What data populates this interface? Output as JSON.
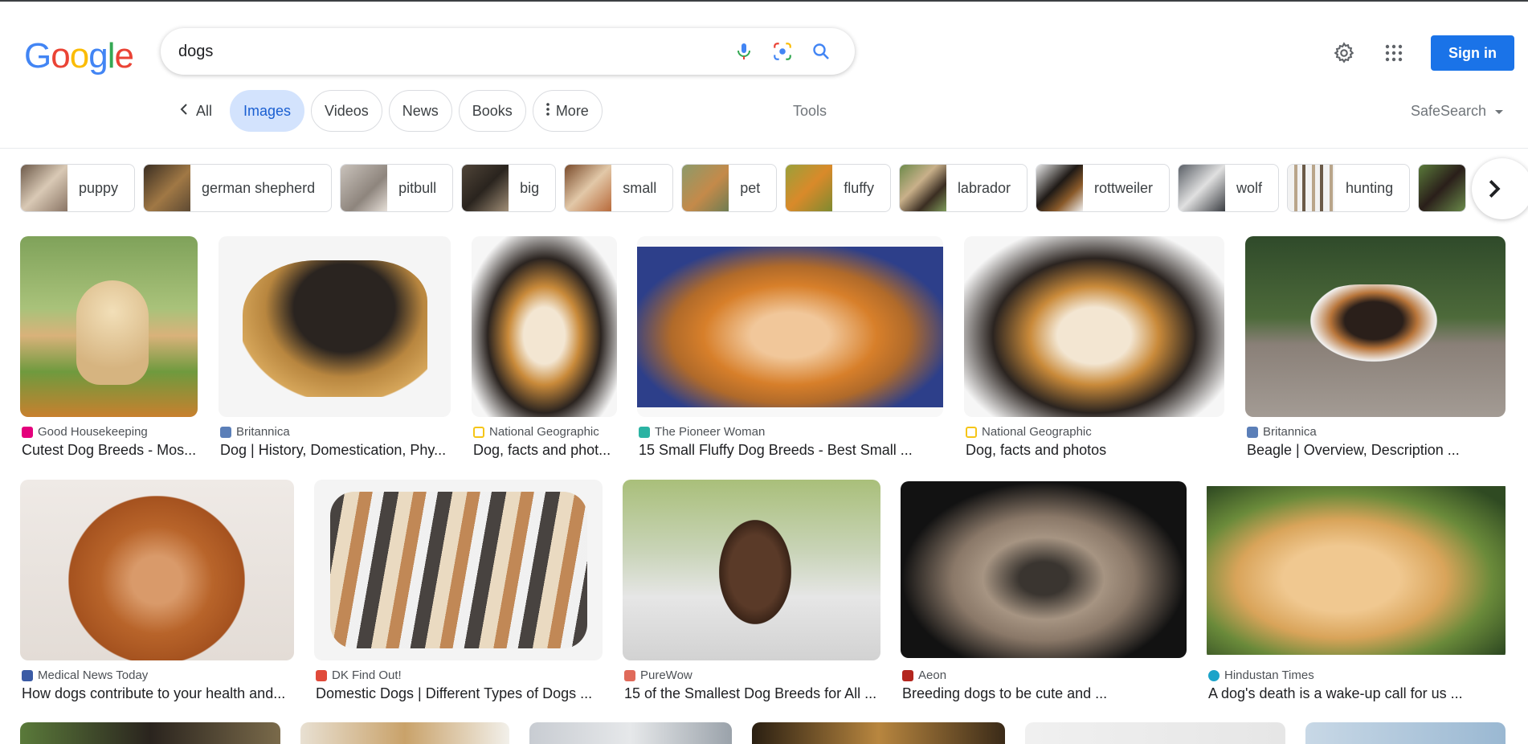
{
  "search": {
    "query": "dogs"
  },
  "header": {
    "sign_in": "Sign in"
  },
  "colors": {
    "accent": "#1a73e8",
    "active_tab_bg": "#d3e3fd"
  },
  "tabs": [
    {
      "label": "All",
      "icon": "chevron-left-icon"
    },
    {
      "label": "Images",
      "active": true
    },
    {
      "label": "Videos"
    },
    {
      "label": "News"
    },
    {
      "label": "Books"
    },
    {
      "label": "More",
      "icon": "more-vert-icon"
    }
  ],
  "tools_label": "Tools",
  "safesearch_label": "SafeSearch",
  "chips": [
    {
      "label": "puppy"
    },
    {
      "label": "german shepherd"
    },
    {
      "label": "pitbull"
    },
    {
      "label": "big"
    },
    {
      "label": "small"
    },
    {
      "label": "pet"
    },
    {
      "label": "fluffy"
    },
    {
      "label": "labrador"
    },
    {
      "label": "rottweiler"
    },
    {
      "label": "wolf"
    },
    {
      "label": "hunting"
    }
  ],
  "results": [
    {
      "source": "Good Housekeeping",
      "title": "Cutest Dog Breeds - Mos..."
    },
    {
      "source": "Britannica",
      "title": "Dog | History, Domestication, Phy..."
    },
    {
      "source": "National Geographic",
      "title": "Dog, facts and phot..."
    },
    {
      "source": "The Pioneer Woman",
      "title": "15 Small Fluffy Dog Breeds - Best Small ..."
    },
    {
      "source": "National Geographic",
      "title": "Dog, facts and photos"
    },
    {
      "source": "Britannica",
      "title": "Beagle | Overview, Description ..."
    },
    {
      "source": "Medical News Today",
      "title": "How dogs contribute to your health and..."
    },
    {
      "source": "DK Find Out!",
      "title": "Domestic Dogs | Different Types of Dogs ..."
    },
    {
      "source": "PureWow",
      "title": "15 of the Smallest Dog Breeds for All ..."
    },
    {
      "source": "Aeon",
      "title": "Breeding dogs to be cute and ..."
    },
    {
      "source": "Hindustan Times",
      "title": "A dog's death is a wake-up call for us ..."
    }
  ]
}
